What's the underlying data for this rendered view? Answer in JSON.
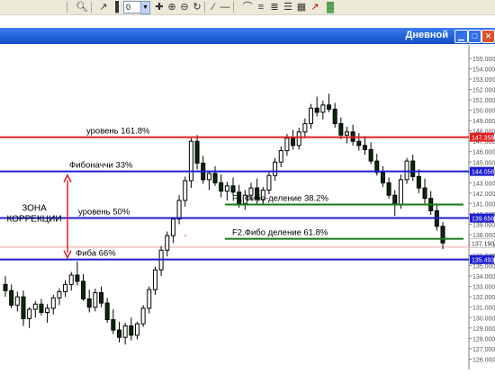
{
  "toolbar": {
    "zoom_value": "0",
    "icons": [
      "search-icon",
      "cursor-icon",
      "chart-bar-icon",
      "crosshair-icon",
      "zoom-in-icon",
      "zoom-out-icon",
      "rotate-icon",
      "trendline-icon",
      "hline-icon",
      "fan-icon",
      "channel-icon",
      "text-icon",
      "arrow-icon",
      "candles-icon"
    ]
  },
  "window": {
    "title": "Дневной"
  },
  "chart_data": {
    "type": "candlestick",
    "y_ticks": [
      "155.000",
      "154.000",
      "153.000",
      "152.000",
      "151.000",
      "150.000",
      "149.000",
      "148.000",
      "147.000",
      "146.000",
      "145.000",
      "144.000",
      "143.000",
      "142.000",
      "141.000",
      "140.000",
      "139.000",
      "138.000",
      "137.000",
      "136.000",
      "135.000",
      "134.000",
      "133.000",
      "132.000",
      "131.000",
      "130.000",
      "129.000",
      "128.000",
      "127.000",
      "126.000"
    ],
    "ylim": [
      125.6,
      155.6
    ],
    "levels": [
      {
        "label": "уровень 161.8%",
        "value": 147.4,
        "color": "#e02020",
        "tag": "147.358",
        "tag_bg": "#e02020"
      },
      {
        "label": "Фибоначчи 33%",
        "value": 144.1,
        "color": "#1c1cd0",
        "tag": "144.056",
        "tag_bg": "#1c1cd0"
      },
      {
        "label": "уровень 50%",
        "value": 139.6,
        "color": "#1c1cd0",
        "tag": "139.656",
        "tag_bg": "#1c1cd0"
      },
      {
        "label": "Фиба 66%",
        "value": 135.6,
        "color": "#1c1cd0",
        "tag": "135.493",
        "tag_bg": "#1c1cd0"
      }
    ],
    "thin_red_level": {
      "value": 136.8
    },
    "current_price": {
      "value": 137.19,
      "tag": "137.190"
    },
    "green_lines": [
      {
        "label": "F1.Фибо-деление 38.2%",
        "value": 140.9,
        "x_from": 0.45,
        "x_to": 1.0
      },
      {
        "label": "F2.Фибо деление 61.8%",
        "value": 137.6,
        "x_from": 0.45,
        "x_to": 1.0
      }
    ],
    "zone_label": [
      "ЗОНА",
      "КОРРЕКЦИИ"
    ],
    "candles": [
      {
        "o": 133.2,
        "h": 134.0,
        "l": 132.0,
        "c": 132.6
      },
      {
        "o": 132.6,
        "h": 133.2,
        "l": 130.9,
        "c": 131.2
      },
      {
        "o": 131.2,
        "h": 132.5,
        "l": 130.6,
        "c": 132.0
      },
      {
        "o": 132.0,
        "h": 132.6,
        "l": 129.2,
        "c": 129.9
      },
      {
        "o": 129.9,
        "h": 131.0,
        "l": 129.0,
        "c": 130.8
      },
      {
        "o": 130.8,
        "h": 131.6,
        "l": 130.0,
        "c": 131.3
      },
      {
        "o": 131.3,
        "h": 131.8,
        "l": 130.2,
        "c": 130.5
      },
      {
        "o": 130.5,
        "h": 131.3,
        "l": 129.5,
        "c": 130.9
      },
      {
        "o": 130.9,
        "h": 132.2,
        "l": 130.3,
        "c": 131.9
      },
      {
        "o": 131.9,
        "h": 132.8,
        "l": 131.2,
        "c": 132.5
      },
      {
        "o": 132.5,
        "h": 133.6,
        "l": 132.0,
        "c": 133.2
      },
      {
        "o": 133.2,
        "h": 134.4,
        "l": 132.6,
        "c": 134.1
      },
      {
        "o": 134.1,
        "h": 135.4,
        "l": 133.1,
        "c": 133.5
      },
      {
        "o": 133.5,
        "h": 134.2,
        "l": 131.6,
        "c": 131.8
      },
      {
        "o": 131.8,
        "h": 132.7,
        "l": 130.5,
        "c": 131.0
      },
      {
        "o": 131.0,
        "h": 132.8,
        "l": 130.6,
        "c": 132.4
      },
      {
        "o": 132.4,
        "h": 133.0,
        "l": 131.0,
        "c": 131.4
      },
      {
        "o": 131.4,
        "h": 131.9,
        "l": 129.5,
        "c": 129.8
      },
      {
        "o": 129.8,
        "h": 130.8,
        "l": 128.4,
        "c": 128.8
      },
      {
        "o": 128.8,
        "h": 129.6,
        "l": 127.6,
        "c": 128.1
      },
      {
        "o": 128.1,
        "h": 129.5,
        "l": 127.4,
        "c": 129.2
      },
      {
        "o": 129.2,
        "h": 130.0,
        "l": 127.8,
        "c": 128.3
      },
      {
        "o": 128.3,
        "h": 129.6,
        "l": 127.9,
        "c": 129.4
      },
      {
        "o": 129.4,
        "h": 131.2,
        "l": 129.1,
        "c": 130.9
      },
      {
        "o": 130.9,
        "h": 133.0,
        "l": 130.4,
        "c": 132.7
      },
      {
        "o": 132.7,
        "h": 134.9,
        "l": 132.2,
        "c": 134.6
      },
      {
        "o": 134.6,
        "h": 136.9,
        "l": 134.0,
        "c": 136.5
      },
      {
        "o": 136.5,
        "h": 138.3,
        "l": 135.9,
        "c": 137.9
      },
      {
        "o": 137.9,
        "h": 139.7,
        "l": 137.2,
        "c": 139.5
      },
      {
        "o": 139.5,
        "h": 141.8,
        "l": 139.0,
        "c": 141.3
      },
      {
        "o": 141.3,
        "h": 143.6,
        "l": 140.7,
        "c": 143.2
      },
      {
        "o": 143.2,
        "h": 147.3,
        "l": 142.5,
        "c": 147.0
      },
      {
        "o": 147.0,
        "h": 147.6,
        "l": 144.3,
        "c": 144.9
      },
      {
        "o": 144.9,
        "h": 145.6,
        "l": 142.9,
        "c": 143.3
      },
      {
        "o": 143.3,
        "h": 144.2,
        "l": 142.3,
        "c": 143.9
      },
      {
        "o": 143.9,
        "h": 144.6,
        "l": 142.7,
        "c": 143.0
      },
      {
        "o": 143.0,
        "h": 143.8,
        "l": 141.6,
        "c": 142.2
      },
      {
        "o": 142.2,
        "h": 143.1,
        "l": 141.3,
        "c": 142.7
      },
      {
        "o": 142.7,
        "h": 143.5,
        "l": 141.8,
        "c": 142.1
      },
      {
        "o": 142.1,
        "h": 142.8,
        "l": 140.6,
        "c": 141.0
      },
      {
        "o": 141.0,
        "h": 142.3,
        "l": 140.4,
        "c": 141.8
      },
      {
        "o": 141.8,
        "h": 143.0,
        "l": 141.3,
        "c": 142.5
      },
      {
        "o": 142.5,
        "h": 143.4,
        "l": 141.0,
        "c": 141.4
      },
      {
        "o": 141.4,
        "h": 142.6,
        "l": 140.9,
        "c": 142.3
      },
      {
        "o": 142.3,
        "h": 144.0,
        "l": 141.9,
        "c": 143.7
      },
      {
        "o": 143.7,
        "h": 145.4,
        "l": 143.2,
        "c": 145.0
      },
      {
        "o": 145.0,
        "h": 146.5,
        "l": 144.5,
        "c": 146.1
      },
      {
        "o": 146.1,
        "h": 147.7,
        "l": 145.6,
        "c": 147.3
      },
      {
        "o": 147.3,
        "h": 148.1,
        "l": 146.2,
        "c": 146.6
      },
      {
        "o": 146.6,
        "h": 148.3,
        "l": 146.2,
        "c": 147.9
      },
      {
        "o": 147.9,
        "h": 149.2,
        "l": 147.3,
        "c": 148.7
      },
      {
        "o": 148.7,
        "h": 150.6,
        "l": 148.2,
        "c": 150.2
      },
      {
        "o": 150.2,
        "h": 151.3,
        "l": 149.4,
        "c": 149.8
      },
      {
        "o": 149.8,
        "h": 150.9,
        "l": 149.1,
        "c": 150.5
      },
      {
        "o": 150.5,
        "h": 151.6,
        "l": 149.8,
        "c": 150.1
      },
      {
        "o": 150.1,
        "h": 150.7,
        "l": 148.3,
        "c": 148.7
      },
      {
        "o": 148.7,
        "h": 149.3,
        "l": 147.2,
        "c": 147.6
      },
      {
        "o": 147.6,
        "h": 148.4,
        "l": 146.8,
        "c": 147.9
      },
      {
        "o": 147.9,
        "h": 148.6,
        "l": 146.6,
        "c": 147.0
      },
      {
        "o": 147.0,
        "h": 147.8,
        "l": 146.1,
        "c": 146.6
      },
      {
        "o": 146.6,
        "h": 147.5,
        "l": 145.7,
        "c": 146.2
      },
      {
        "o": 146.2,
        "h": 146.9,
        "l": 144.8,
        "c": 145.1
      },
      {
        "o": 145.1,
        "h": 145.8,
        "l": 143.7,
        "c": 144.0
      },
      {
        "o": 144.0,
        "h": 144.6,
        "l": 142.6,
        "c": 143.0
      },
      {
        "o": 143.0,
        "h": 143.5,
        "l": 141.5,
        "c": 141.8
      },
      {
        "o": 141.8,
        "h": 142.3,
        "l": 139.8,
        "c": 140.9
      },
      {
        "o": 140.9,
        "h": 143.8,
        "l": 140.5,
        "c": 143.3
      },
      {
        "o": 143.3,
        "h": 145.4,
        "l": 142.9,
        "c": 145.1
      },
      {
        "o": 145.1,
        "h": 145.7,
        "l": 143.2,
        "c": 143.6
      },
      {
        "o": 143.6,
        "h": 144.3,
        "l": 142.0,
        "c": 142.5
      },
      {
        "o": 142.5,
        "h": 143.4,
        "l": 141.0,
        "c": 141.5
      },
      {
        "o": 141.5,
        "h": 142.2,
        "l": 139.9,
        "c": 140.3
      },
      {
        "o": 140.3,
        "h": 141.0,
        "l": 138.4,
        "c": 138.8
      },
      {
        "o": 138.8,
        "h": 139.2,
        "l": 136.6,
        "c": 137.2
      }
    ]
  }
}
